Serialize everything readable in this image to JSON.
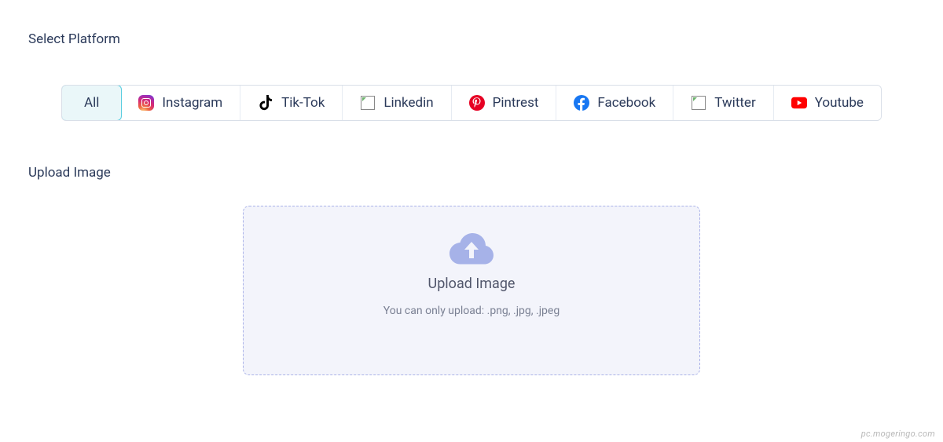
{
  "sections": {
    "platform_title": "Select Platform",
    "upload_title": "Upload Image"
  },
  "platforms": [
    {
      "id": "all",
      "label": "All",
      "icon": null,
      "active": true
    },
    {
      "id": "instagram",
      "label": "Instagram",
      "icon": "instagram",
      "active": false
    },
    {
      "id": "tiktok",
      "label": "Tik-Tok",
      "icon": "tiktok",
      "active": false
    },
    {
      "id": "linkedin",
      "label": "Linkedin",
      "icon": "broken",
      "active": false
    },
    {
      "id": "pinterest",
      "label": "Pintrest",
      "icon": "pinterest",
      "active": false
    },
    {
      "id": "facebook",
      "label": "Facebook",
      "icon": "facebook",
      "active": false
    },
    {
      "id": "twitter",
      "label": "Twitter",
      "icon": "broken",
      "active": false
    },
    {
      "id": "youtube",
      "label": "Youtube",
      "icon": "youtube",
      "active": false
    }
  ],
  "upload": {
    "title": "Upload Image",
    "hint": "You can only upload: .png, .jpg, .jpeg"
  },
  "watermark": "pc.mogeringo.com"
}
